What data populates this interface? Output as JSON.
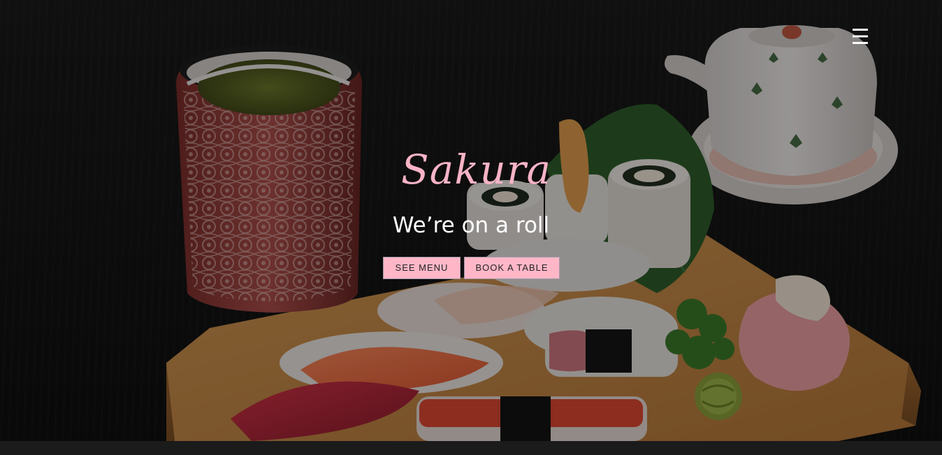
{
  "brand": {
    "name": "Sakura",
    "tagline": "We’re on a roll"
  },
  "buttons": {
    "see_menu": "SEE MENU",
    "book_table": "BOOK A TABLE"
  },
  "nav": {
    "menu_icon": "hamburger-icon",
    "menu_glyph": "☰"
  },
  "colors": {
    "accent_pink": "#ffb7c8",
    "brand_pink": "#f7b3c6",
    "text_white": "#ffffff",
    "background": "#141414"
  }
}
